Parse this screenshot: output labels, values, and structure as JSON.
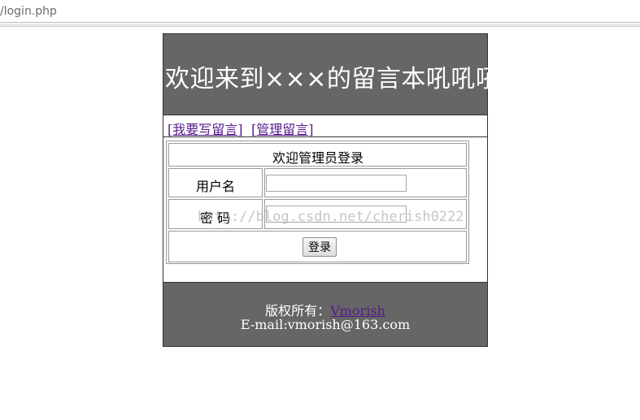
{
  "browser": {
    "url": "/login.php"
  },
  "header": {
    "title": "欢迎来到×××的留言本吼吼吼"
  },
  "nav": {
    "write_link": "[我要写留言]",
    "manage_link": "[管理留言]"
  },
  "login": {
    "heading": "欢迎管理员登录",
    "username_label": "用户名",
    "username_value": "",
    "password_label": "密 码",
    "password_value": "",
    "submit_label": "登录"
  },
  "footer": {
    "copyright_prefix": "版权所有：",
    "author_link": "Vmorish",
    "email_line": "E-mail:vmorish@163.com"
  },
  "watermark": {
    "text": "http://blog.csdn.net/cherish0222"
  },
  "colors": {
    "header_bg": "#666666",
    "link": "#551a8b",
    "border": "#333333"
  }
}
